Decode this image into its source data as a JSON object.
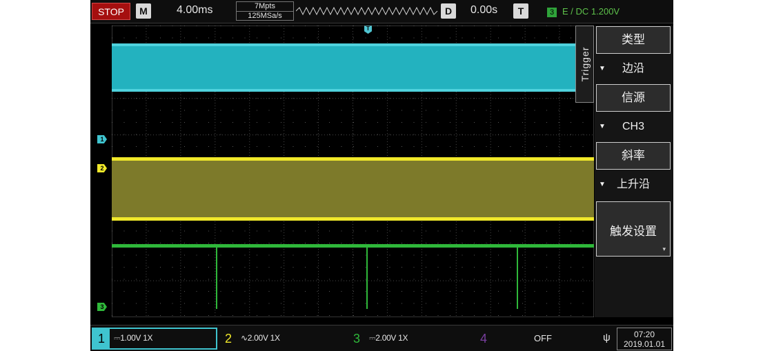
{
  "topbar": {
    "run_state": "STOP",
    "m_label": "M",
    "timebase": "4.00ms",
    "memory_depth": "7Mpts",
    "sample_rate": "125MSa/s",
    "d_label": "D",
    "delay": "0.00s",
    "t_label": "T",
    "trigger_channel": "3",
    "trigger_info": "E /  DC 1.200V"
  },
  "colors": {
    "ch1": "#3fc4cf",
    "ch2": "#f0e82a",
    "ch3": "#2fb83a",
    "ch4": "#7a3fa0",
    "stop": "#a50f0f"
  },
  "markers": {
    "ch1": "1",
    "ch2": "2",
    "ch3": "3",
    "trigger_position": "T"
  },
  "menu": {
    "tab_label": "Trigger",
    "items": [
      {
        "label": "类型",
        "value": "边沿"
      },
      {
        "label": "信源",
        "value": "CH3"
      },
      {
        "label": "斜率",
        "value": "上升沿"
      }
    ],
    "settings_button": "触发设置",
    "more_glyph": "▾"
  },
  "channels": [
    {
      "num": "1",
      "setting": "1.00V 1X"
    },
    {
      "num": "2",
      "setting": "2.00V 1X"
    },
    {
      "num": "3",
      "setting": "2.00V 1X"
    },
    {
      "num": "4",
      "setting": "OFF"
    }
  ],
  "status": {
    "usb_icon": "usb-icon",
    "time": "07:20",
    "date": "2019.01.01"
  }
}
